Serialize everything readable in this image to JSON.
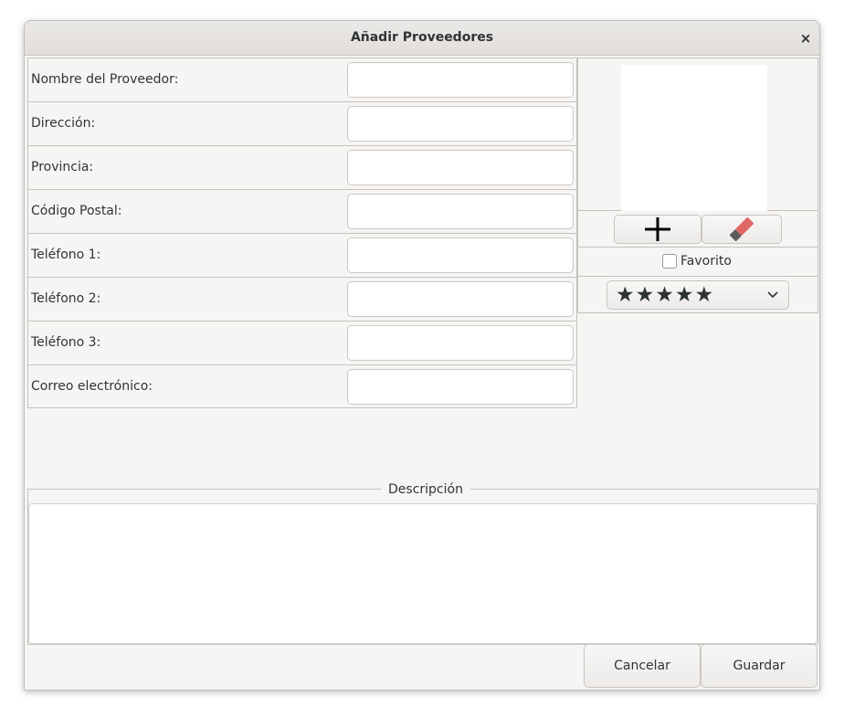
{
  "window": {
    "title": "Añadir Proveedores",
    "close_symbol": "×"
  },
  "form": {
    "fields": [
      {
        "label": "Nombre del Proveedor:",
        "value": ""
      },
      {
        "label": "Dirección:",
        "value": ""
      },
      {
        "label": "Provincia:",
        "value": ""
      },
      {
        "label": "Código Postal:",
        "value": ""
      },
      {
        "label": "Teléfono 1:",
        "value": ""
      },
      {
        "label": "Teléfono 2:",
        "value": ""
      },
      {
        "label": "Teléfono 3:",
        "value": ""
      },
      {
        "label": "Correo electrónico:",
        "value": ""
      }
    ]
  },
  "image_panel": {
    "add_icon": "plus-icon",
    "clear_icon": "eraser-icon",
    "favorite_label": "Favorito",
    "favorite_checked": false,
    "rating_value": 5,
    "rating_max": 5,
    "rating_stars": "★★★★★"
  },
  "description": {
    "legend": "Descripción",
    "value": ""
  },
  "actions": {
    "cancel_label": "Cancelar",
    "save_label": "Guardar"
  },
  "colors": {
    "window_bg": "#f6f5f4",
    "border": "#c5c2bd",
    "eraser": "#e06666"
  }
}
